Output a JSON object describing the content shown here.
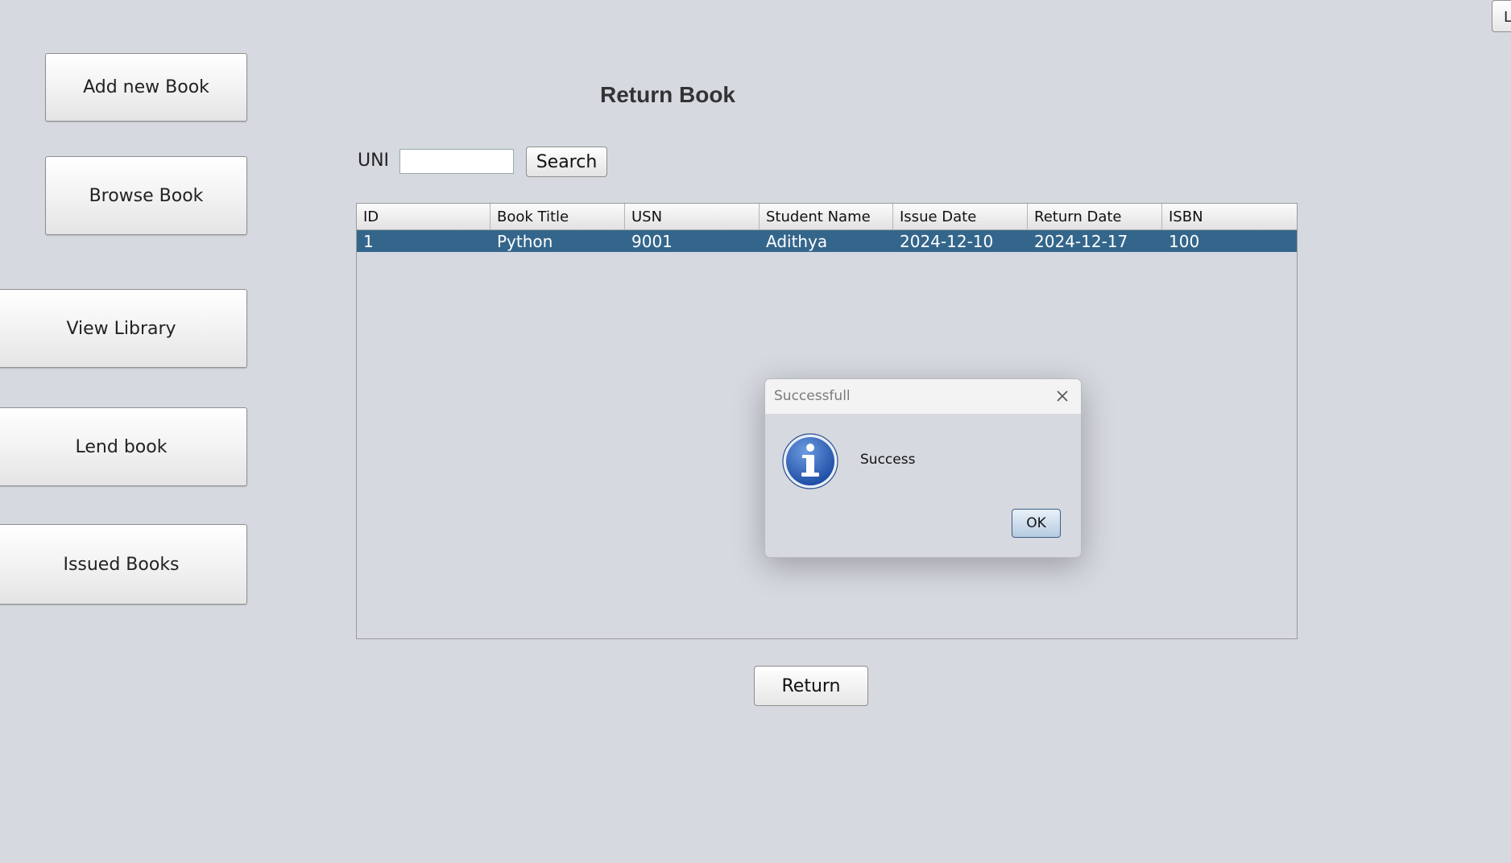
{
  "sidebar": {
    "add_new_book": "Add new Book",
    "browse_book": "Browse Book",
    "view_library": "View Library",
    "lend_book": "Lend book",
    "issued_books": "Issued Books"
  },
  "corner_button": "L",
  "page_title": "Return Book",
  "search": {
    "label": "UNI",
    "value": "",
    "button": "Search"
  },
  "table": {
    "columns": [
      "ID",
      "Book Title",
      "USN",
      "Student Name",
      "Issue Date",
      "Return Date",
      "ISBN"
    ],
    "rows": [
      [
        "1",
        "Python",
        "9001",
        "Adithya",
        "2024-12-10",
        "2024-12-17",
        "100"
      ]
    ],
    "selected_row_color": "#34668c"
  },
  "return_button": "Return",
  "dialog": {
    "title": "Successfull",
    "icon": "info-icon",
    "message": "Success",
    "ok": "OK"
  }
}
